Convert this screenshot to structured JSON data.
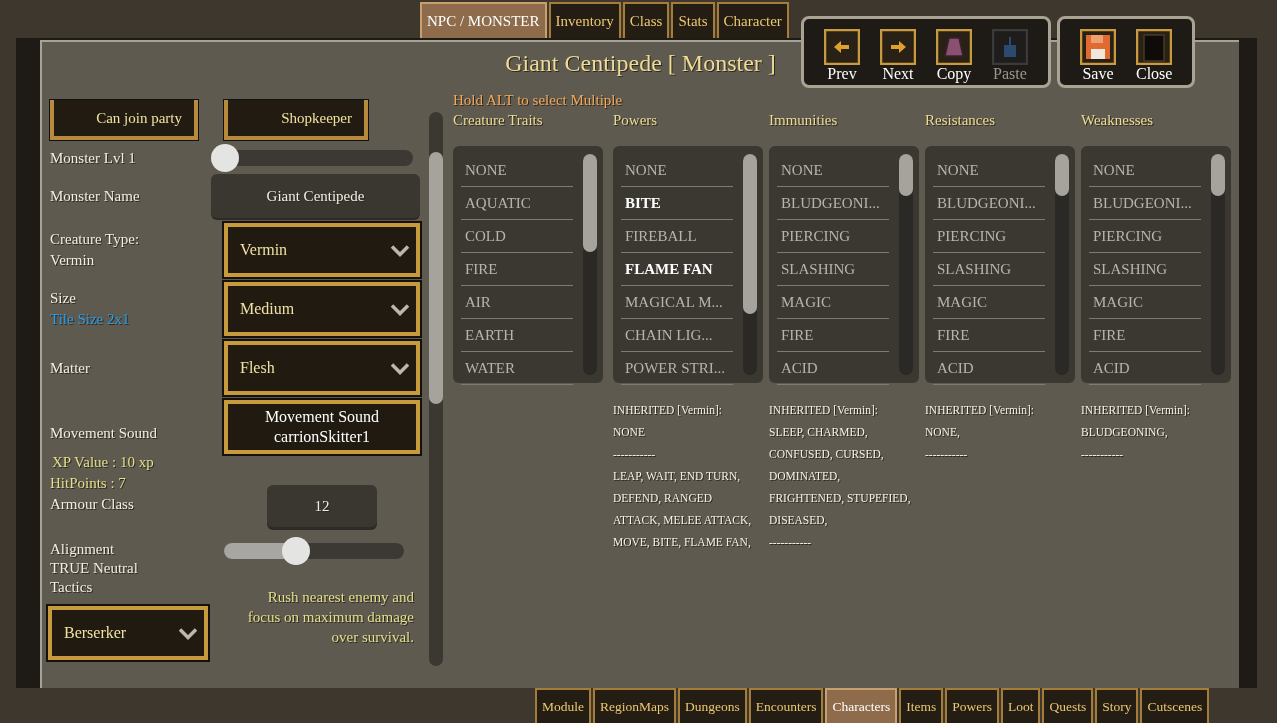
{
  "top_tabs": [
    {
      "label": "NPC / MONSTER",
      "selected": true
    },
    {
      "label": "Inventory",
      "selected": false
    },
    {
      "label": "Class",
      "selected": false
    },
    {
      "label": "Stats",
      "selected": false
    },
    {
      "label": "Character",
      "selected": false
    }
  ],
  "title": "Giant Centipede [ Monster ]",
  "toolbar": [
    [
      {
        "label": "Prev",
        "kind": "prev",
        "disabled": false
      },
      {
        "label": "Next",
        "kind": "next",
        "disabled": false
      },
      {
        "label": "Copy",
        "kind": "copy",
        "disabled": false
      },
      {
        "label": "Paste",
        "kind": "paste",
        "disabled": true
      }
    ],
    [
      {
        "label": "Save",
        "kind": "save",
        "disabled": false
      },
      {
        "label": "Close",
        "kind": "close",
        "disabled": false
      }
    ]
  ],
  "left": {
    "toggles": [
      "Can join party",
      "Shopkeeper"
    ],
    "level_label": "Monster Lvl 1",
    "level_slider": {
      "level": 0
    },
    "name_label": "Monster Name",
    "name_value": "Giant Centipede",
    "creature_type_label": "Creature Type:",
    "creature_type_value": "Vermin",
    "creature_type_select": "Vermin",
    "size_label": "Size",
    "tile_size": "Tile Size 2x1",
    "size_select": "Medium",
    "matter_label": "Matter",
    "matter_select": "Flesh",
    "movement_label": "Movement Sound",
    "movement_button": [
      "Movement Sound",
      "carrionSkitter1"
    ],
    "xp": "XP Value : 10 xp",
    "hp": "HitPoints : 7",
    "armour_label": "Armour Class",
    "armour_value": "12",
    "alignment_label": "Alignment",
    "alignment_value": "TRUE Neutral",
    "alignment_slider": {
      "level": 0.38
    },
    "tactics_label": "Tactics",
    "tactics_select": "Berserker",
    "tactics_description": "Rush nearest enemy and focus on maximum damage over survival."
  },
  "hint": "Hold ALT to select Multiple",
  "lists": [
    {
      "title": "Creature Traits",
      "items": [
        {
          "label": "NONE",
          "selected": false
        },
        {
          "label": "AQUATIC",
          "selected": false
        },
        {
          "label": "COLD",
          "selected": false
        },
        {
          "label": "FIRE",
          "selected": false
        },
        {
          "label": "AIR",
          "selected": false
        },
        {
          "label": "EARTH",
          "selected": false
        },
        {
          "label": "WATER",
          "selected": false
        }
      ]
    },
    {
      "title": "Powers",
      "items": [
        {
          "label": "NONE",
          "selected": false
        },
        {
          "label": "BITE",
          "selected": true
        },
        {
          "label": "FIREBALL",
          "selected": false
        },
        {
          "label": "FLAME FAN",
          "selected": true
        },
        {
          "label": "MAGICAL M...",
          "selected": false
        },
        {
          "label": "CHAIN LIG...",
          "selected": false
        },
        {
          "label": "POWER STRI...",
          "selected": false
        }
      ],
      "inherited": [
        "INHERITED [Vermin]:",
        "NONE",
        "-----------",
        "LEAP, WAIT, END TURN, DEFEND, RANGED ATTACK, MELEE ATTACK, MOVE, BITE, FLAME FAN,"
      ]
    },
    {
      "title": "Immunities",
      "items": [
        {
          "label": "NONE",
          "selected": false
        },
        {
          "label": "BLUDGEONI...",
          "selected": false
        },
        {
          "label": "PIERCING",
          "selected": false
        },
        {
          "label": "SLASHING",
          "selected": false
        },
        {
          "label": "MAGIC",
          "selected": false
        },
        {
          "label": "FIRE",
          "selected": false
        },
        {
          "label": "ACID",
          "selected": false
        }
      ],
      "inherited": [
        "INHERITED [Vermin]:",
        "SLEEP, CHARMED, CONFUSED, CURSED, DOMINATED, FRIGHTENED, STUPEFIED, DISEASED,",
        "-----------"
      ]
    },
    {
      "title": "Resistances",
      "items": [
        {
          "label": "NONE",
          "selected": false
        },
        {
          "label": "BLUDGEONI...",
          "selected": false
        },
        {
          "label": "PIERCING",
          "selected": false
        },
        {
          "label": "SLASHING",
          "selected": false
        },
        {
          "label": "MAGIC",
          "selected": false
        },
        {
          "label": "FIRE",
          "selected": false
        },
        {
          "label": "ACID",
          "selected": false
        }
      ],
      "inherited": [
        "INHERITED [Vermin]:",
        "NONE,",
        "-----------"
      ]
    },
    {
      "title": "Weaknesses",
      "items": [
        {
          "label": "NONE",
          "selected": false
        },
        {
          "label": "BLUDGEONI...",
          "selected": false
        },
        {
          "label": "PIERCING",
          "selected": false
        },
        {
          "label": "SLASHING",
          "selected": false
        },
        {
          "label": "MAGIC",
          "selected": false
        },
        {
          "label": "FIRE",
          "selected": false
        },
        {
          "label": "ACID",
          "selected": false
        }
      ],
      "inherited": [
        "INHERITED [Vermin]:",
        "BLUDGEONING,",
        "-----------"
      ]
    }
  ],
  "bottom_tabs": [
    {
      "label": "Module",
      "selected": false
    },
    {
      "label": "RegionMaps",
      "selected": false
    },
    {
      "label": "Dungeons",
      "selected": false
    },
    {
      "label": "Encounters",
      "selected": false
    },
    {
      "label": "Characters",
      "selected": true
    },
    {
      "label": "Items",
      "selected": false
    },
    {
      "label": "Powers",
      "selected": false
    },
    {
      "label": "Loot",
      "selected": false
    },
    {
      "label": "Quests",
      "selected": false
    },
    {
      "label": "Story",
      "selected": false
    },
    {
      "label": "Cutscenes",
      "selected": false
    }
  ]
}
